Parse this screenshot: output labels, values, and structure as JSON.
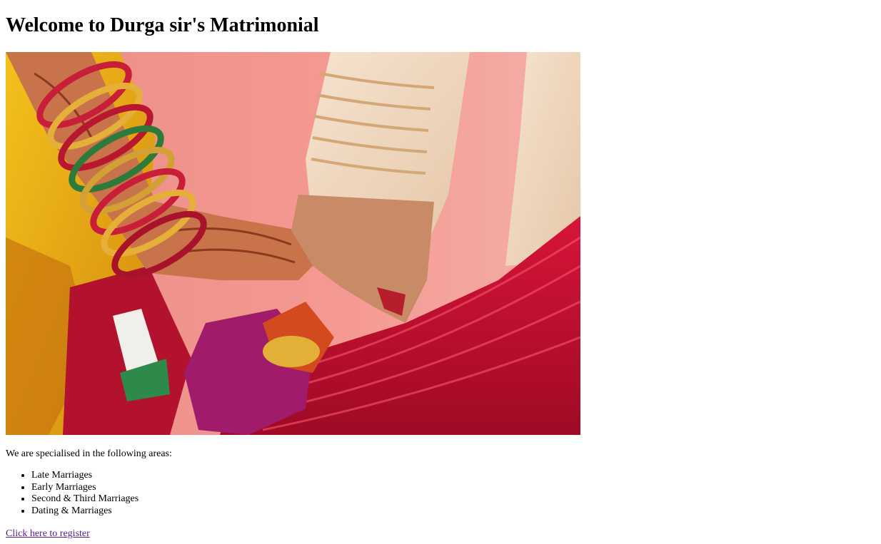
{
  "page": {
    "heading": "Welcome to Durga sir's Matrimonial",
    "hero_image": {
      "description_icon": "wedding-hands-photo"
    },
    "intro_text": "We are specialised in the following areas:",
    "services": [
      "Late Marriages",
      "Early Marriages",
      "Second & Third Marriages",
      "Dating & Marriages"
    ],
    "register_link": "Click here to register"
  },
  "colors": {
    "link_visited": "#551a8b",
    "text": "#000000",
    "background": "#ffffff"
  }
}
